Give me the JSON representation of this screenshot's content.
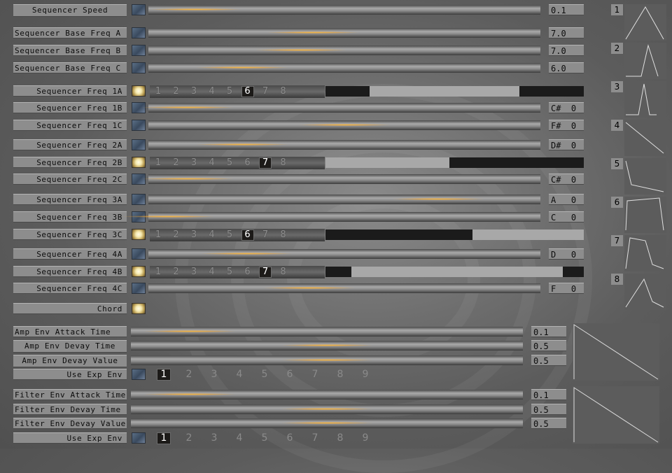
{
  "sequencer": {
    "speed": {
      "label": "Sequencer Speed",
      "value": "0.1",
      "glow": 0.12
    },
    "base_freqs": [
      {
        "label": "Sequencer Base Freq A",
        "value": "7.0",
        "glow": 0.42
      },
      {
        "label": "Sequencer Base Freq B",
        "value": "7.0",
        "glow": 0.39
      },
      {
        "label": "Sequencer Base Freq C",
        "value": "6.0",
        "glow": 0.24
      }
    ],
    "freq_rows": [
      {
        "label": "Sequencer Freq 1A",
        "type": "steps",
        "selected_step": 6,
        "range": [
          0.17,
          0.75
        ]
      },
      {
        "label": "Sequencer Freq 1B",
        "type": "slider",
        "value": "C#  0",
        "glow": 0.1
      },
      {
        "label": "Sequencer Freq 1C",
        "type": "slider",
        "value": "F#  0",
        "glow": 0.5
      },
      {
        "label": "Sequencer Freq 2A",
        "type": "slider",
        "value": "D#  0",
        "glow": 0.24
      },
      {
        "label": "Sequencer Freq 2B",
        "type": "steps",
        "selected_step": 7,
        "range": [
          0.0,
          0.48
        ]
      },
      {
        "label": "Sequencer Freq 2C",
        "type": "slider",
        "value": "C#  0",
        "glow": 0.1
      },
      {
        "label": "Sequencer Freq 3A",
        "type": "slider",
        "value": "A   0",
        "glow": 0.74
      },
      {
        "label": "Sequencer Freq 3B",
        "type": "slider",
        "value": "C   0",
        "glow": 0.05
      },
      {
        "label": "Sequencer Freq 3C",
        "type": "steps",
        "selected_step": 6,
        "range": [
          0.57,
          1.0
        ]
      },
      {
        "label": "Sequencer Freq 4A",
        "type": "slider",
        "value": "D   0",
        "glow": 0.25
      },
      {
        "label": "Sequencer Freq 4B",
        "type": "steps",
        "selected_step": 7,
        "range": [
          0.1,
          0.92
        ]
      },
      {
        "label": "Sequencer Freq 4C",
        "type": "slider",
        "value": "F   0",
        "glow": 0.41
      }
    ],
    "step_numbers": [
      "1",
      "2",
      "3",
      "4",
      "5",
      "6",
      "7",
      "8"
    ]
  },
  "chord": {
    "label": "Chord"
  },
  "amp_env": {
    "attack": {
      "label": "Amp Env Attack Time",
      "value": "0.1",
      "glow": 0.15
    },
    "decay_time": {
      "label": "Amp Env Devay Time",
      "value": "0.5",
      "glow": 0.5
    },
    "decay_value": {
      "label": "Amp Env Devay Value",
      "value": "0.5",
      "glow": 0.5
    },
    "use_exp": {
      "label": "Use Exp Env",
      "selected": 1
    }
  },
  "filter_env": {
    "attack": {
      "label": "Filter Env Attack Time",
      "value": "0.1",
      "glow": 0.15
    },
    "decay_time": {
      "label": "Filter Env Devay Time",
      "value": "0.5",
      "glow": 0.5
    },
    "decay_value": {
      "label": "Filter Env Devay Value",
      "value": "0.5",
      "glow": 0.5
    },
    "use_exp": {
      "label": "Use Exp Env",
      "selected": 1
    }
  },
  "exp_numbers": [
    "1",
    "2",
    "3",
    "4",
    "5",
    "6",
    "7",
    "8",
    "9"
  ],
  "waveform_labels": [
    "1",
    "2",
    "3",
    "4",
    "5",
    "6",
    "7",
    "8"
  ],
  "colors": {
    "glow": "#ffb43c",
    "lit": "#fff6d0",
    "panel": "#8d8d8d"
  }
}
